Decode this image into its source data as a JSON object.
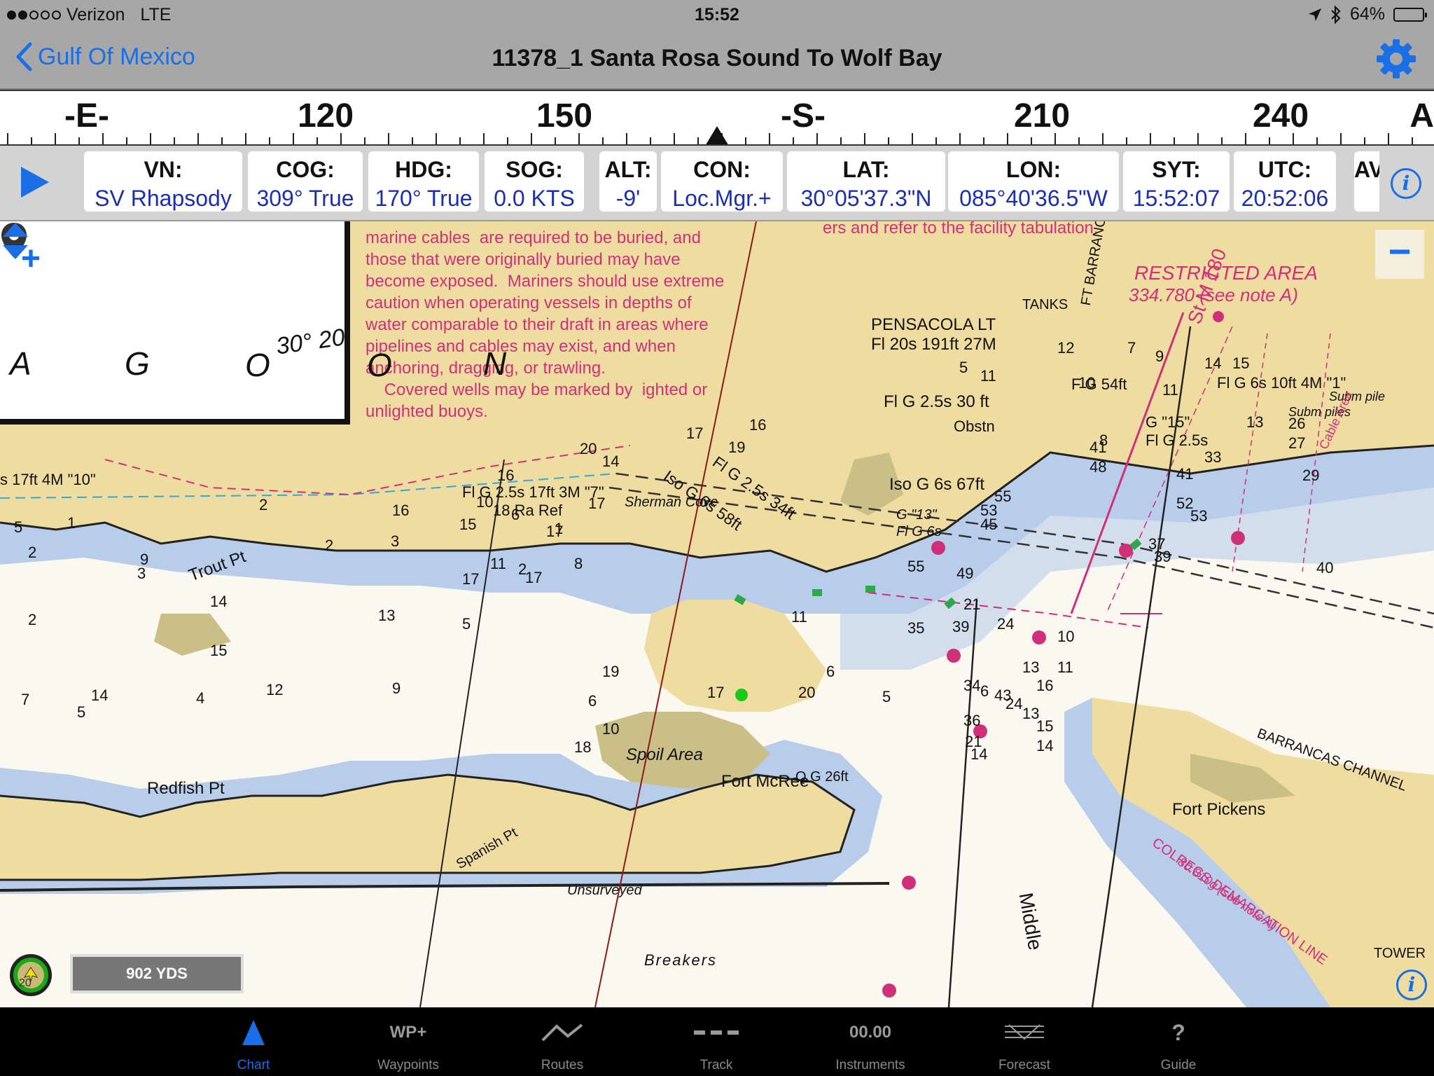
{
  "status_bar": {
    "carrier": "Verizon",
    "network": "LTE",
    "time": "15:52",
    "battery": "64%"
  },
  "nav": {
    "back_label": "Gulf Of Mexico",
    "title": "11378_1 Santa Rosa Sound To Wolf Bay"
  },
  "compass": {
    "labels": [
      "-E-",
      "120",
      "150",
      "-S-",
      "210",
      "240",
      "A"
    ]
  },
  "instruments": [
    {
      "label": "VN:",
      "value": "SV Rhapsody"
    },
    {
      "label": "COG:",
      "value": "309° True"
    },
    {
      "label": "HDG:",
      "value": "170° True"
    },
    {
      "label": "SOG:",
      "value": "0.0 KTS"
    },
    {
      "label": "ALT:",
      "value": "-9'"
    },
    {
      "label": "CON:",
      "value": "Loc.Mgr.+"
    },
    {
      "label": "LAT:",
      "value": "30°05'37.3\"N"
    },
    {
      "label": "LON:",
      "value": "085°40'36.5\"W"
    },
    {
      "label": "SYT:",
      "value": "15:52:07"
    },
    {
      "label": "UTC:",
      "value": "20:52:06"
    },
    {
      "label": "AV",
      "value": ""
    }
  ],
  "chart": {
    "note": "marine cables  are required to be buried, and\nthose that were originally buried may have\nbecome exposed.  Mariners should use extreme\ncaution when operating vessels in depths of\nwater comparable to their draft in areas where\npipelines and cables may exist, and when\nanchoring, dragging, or trawling.\n    Covered wells may be marked by  ighted or\nunlighted buoys.",
    "note_top": "ers and refer to the  facility  tabulation.",
    "restricted_area": "RESTRICTED AREA",
    "restricted_area_sub": "334.780 (see note A)",
    "pensacola_lt": "PENSACOLA LT",
    "pensacola_lt_sub": "Fl 20s 191ft 27M",
    "tanks": "TANKS",
    "ft_barrancas": "FT BARRANCAS RGE",
    "fl_g_54": "F G 54ft",
    "fl_g_25_30": "Fl G 2.5s 30 ft",
    "obstn": "Obstn",
    "iso_g_6s_67": "Iso G 6s 67ft",
    "iso_g_6s_58": "Iso G 6s 58ft",
    "fl_g_25_34": "Fl G 2.5s 34ft",
    "sherman_cove": "Sherman Cove",
    "trout_pt": "Trout Pt",
    "redfish_pt": "Redfish Pt",
    "spanish_pt": "Spanish Pt",
    "spoil_area": "Spoil Area",
    "fort_mcree": "Fort McRee",
    "fort_pickens": "Fort Pickens",
    "barrancas_channel": "BARRANCAS CHANNEL",
    "colregs": "COLREGS DEMARCATION LINE",
    "colregs_sub": "80.810g (see note A)",
    "unsurveyed": "Unsurveyed",
    "breakers": "Breakers",
    "middle": "Middle",
    "tower": "TOWER",
    "piles": "Piles",
    "subm_piles": "Subm piles",
    "subm_pile": "Subm pile",
    "cable_area": "Cable Area",
    "fl_g_17_3m": "Fl G 2.5s 17ft 3M \"7\"",
    "ra_ref": "18 Ra Ref",
    "s_17ft": "s 17ft 4M \"10\"",
    "q_g_26": "Q G 26ft",
    "g_15": "G \"15\"",
    "fl_g_25": "Fl G 2.5s",
    "fl_g_6s_10": "Fl G 6s 10ft 4M \"1\"",
    "g_13": "G \"13\"",
    "fl_g_6s": "Fl G 6s",
    "lat_label": "30° 20'",
    "lagoon": [
      "A",
      "G",
      "O",
      "O",
      "N"
    ],
    "st_m_180": "St M 180",
    "soundings": [
      "12",
      "7",
      "9",
      "8",
      "5",
      "11",
      "10",
      "11",
      "14",
      "15",
      "13",
      "41",
      "48",
      "26",
      "27",
      "33",
      "29",
      "41",
      "55",
      "53",
      "45",
      "52",
      "53",
      "37",
      "39",
      "40",
      "55",
      "49",
      "21",
      "35",
      "39",
      "24",
      "10",
      "13",
      "11",
      "16",
      "6",
      "43",
      "24",
      "34",
      "36",
      "21",
      "14",
      "13",
      "15",
      "14",
      "16",
      "17",
      "19",
      "20",
      "14",
      "17",
      "17",
      "15",
      "16",
      "3",
      "2",
      "9",
      "2",
      "5",
      "2",
      "3",
      "1",
      "2",
      "1",
      "8",
      "10",
      "6",
      "16",
      "17",
      "11",
      "14",
      "17",
      "20",
      "12",
      "9",
      "7",
      "5",
      "4",
      "6",
      "10",
      "18",
      "19",
      "5",
      "13",
      "17",
      "15",
      "14",
      "2",
      "11",
      "6",
      "5"
    ]
  },
  "scale_bar": "902 YDS",
  "location_badge": "20",
  "tabs": [
    {
      "label": "Chart",
      "icon": "triangle-icon"
    },
    {
      "label": "Waypoints",
      "icon": "WP+"
    },
    {
      "label": "Routes",
      "icon": "route-icon"
    },
    {
      "label": "Track",
      "icon": "track-icon"
    },
    {
      "label": "Instruments",
      "icon": "00.00"
    },
    {
      "label": "Forecast",
      "icon": "forecast-icon"
    },
    {
      "label": "Guide",
      "icon": "?"
    }
  ],
  "colors": {
    "accent": "#1b6fe6",
    "land": "#efdca0",
    "shallow_water": "#b8cde9",
    "deep_water": "#fbf8f0",
    "magenta": "#d0307a",
    "marsh": "#c9bf87"
  }
}
